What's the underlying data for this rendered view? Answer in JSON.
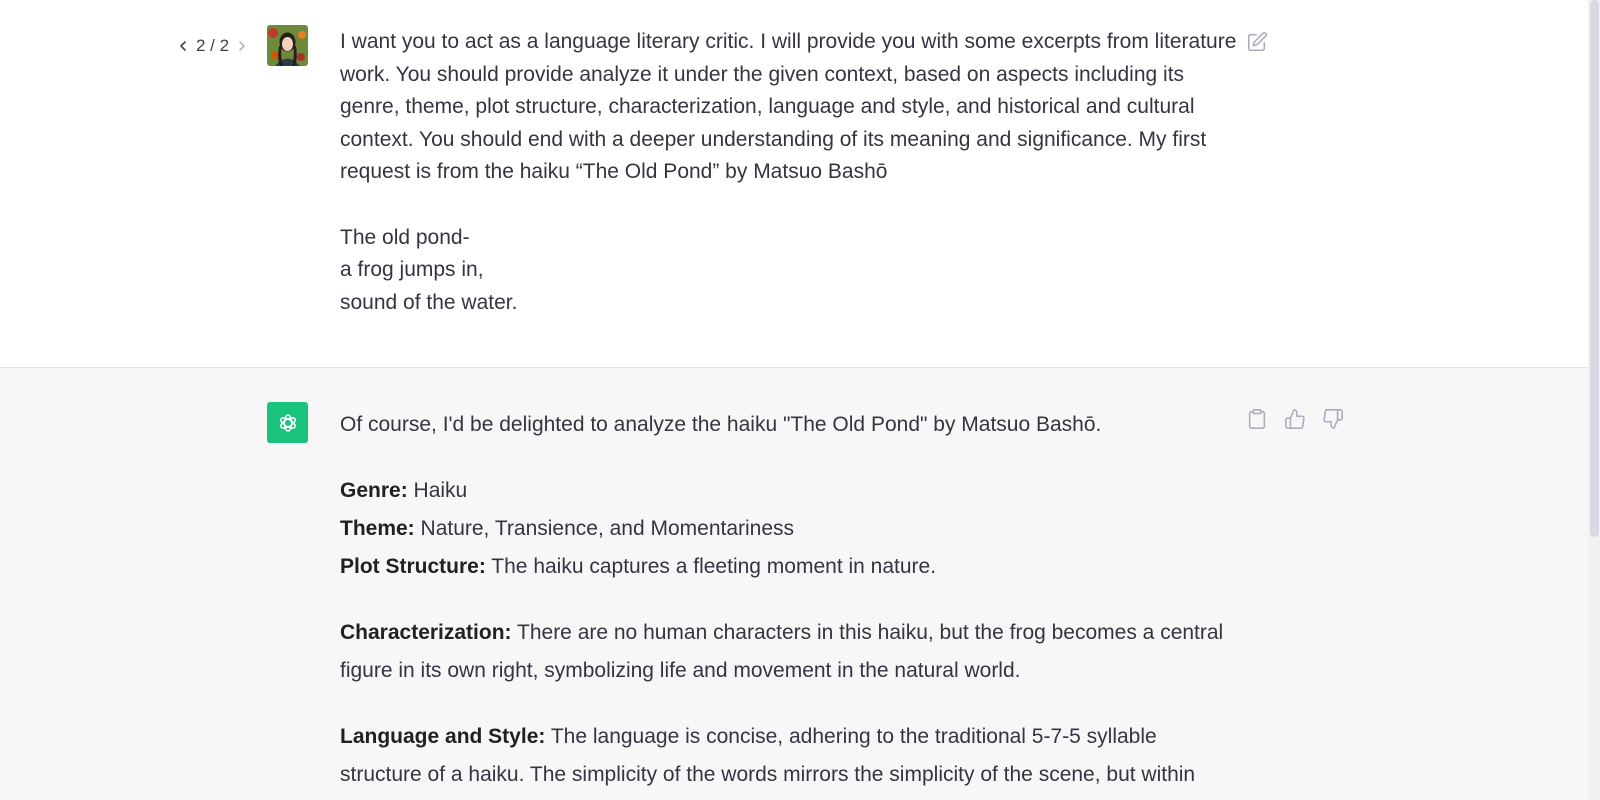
{
  "user_message": {
    "pager": {
      "label": "2 / 2",
      "prev_icon": "chevron-left-icon",
      "next_icon": "chevron-right-icon"
    },
    "avatar_icon": "user-avatar",
    "paragraph": "I want you to act as a language literary critic. I will provide you with some excerpts from literature work. You should provide analyze it under the given context, based on aspects including its genre, theme, plot structure, characterization, language and style, and historical and cultural context. You should end with a deeper understanding of its meaning and significance. My first request is from the haiku “The Old Pond” by Matsuo Bashō",
    "poem_lines": [
      "The old pond-",
      "a frog jumps in,",
      "sound of the water."
    ],
    "edit_icon": "edit-icon"
  },
  "assistant_message": {
    "avatar_icon": "openai-logo-icon",
    "intro": "Of course, I'd be delighted to analyze the haiku \"The Old Pond\" by Matsuo Bashō.",
    "genre": {
      "label": "Genre:",
      "text": " Haiku"
    },
    "theme": {
      "label": "Theme:",
      "text": " Nature, Transience, and Momentariness"
    },
    "plot": {
      "label": "Plot Structure:",
      "text": " The haiku captures a fleeting moment in nature."
    },
    "characterization": {
      "label": "Characterization:",
      "text": " There are no human characters in this haiku, but the frog becomes a central figure in its own right, symbolizing life and movement in the natural world."
    },
    "language_style": {
      "label": "Language and Style:",
      "text": " The language is concise, adhering to the traditional 5-7-5 syllable structure of a haiku. The simplicity of the words mirrors the simplicity of the scene, but within"
    },
    "actions": {
      "copy_icon": "clipboard-icon",
      "like_icon": "thumbs-up-icon",
      "dislike_icon": "thumbs-down-icon"
    }
  },
  "colors": {
    "assistant_bg": "#f7f7f8",
    "brand_green": "#19c37d",
    "text": "#343541",
    "icon_gray": "#acacbe"
  }
}
